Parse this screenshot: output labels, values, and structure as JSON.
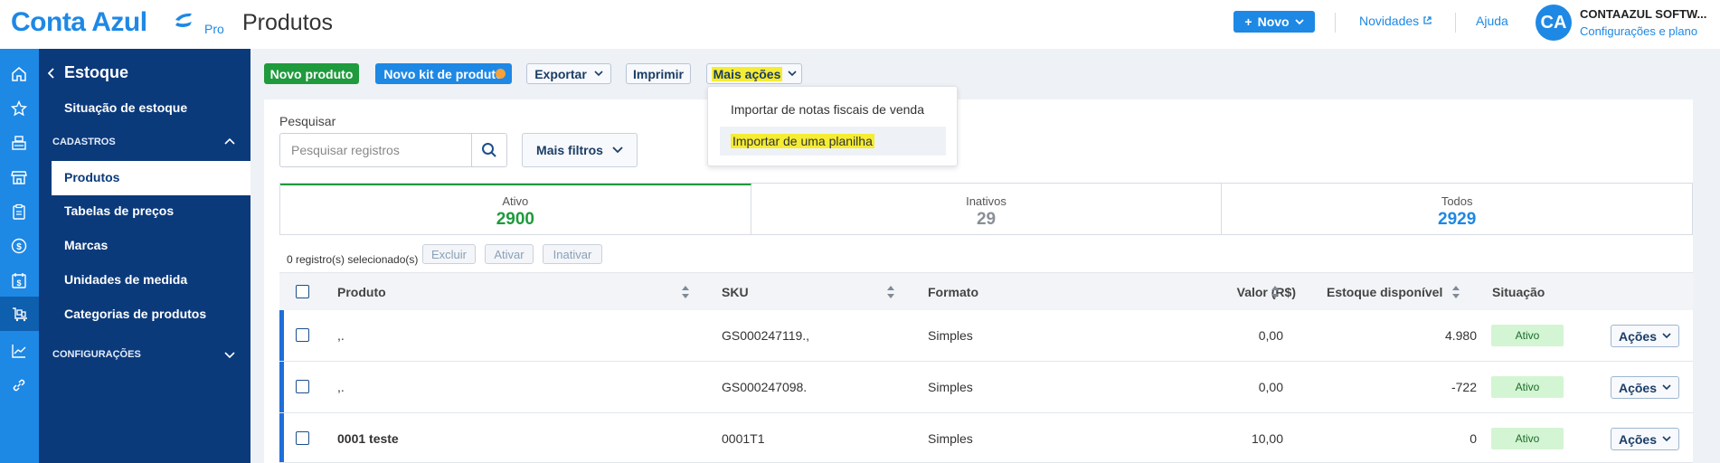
{
  "header": {
    "logo_text": "Conta Azul",
    "logo_badge": "Pro",
    "page_title": "Produtos",
    "novo_label": "Novo",
    "novidades_label": "Novidades",
    "ajuda_label": "Ajuda",
    "avatar_initials": "CA",
    "company_name": "CONTAAZUL SOFTW...",
    "plan_link": "Configurações e plano",
    "brand_color": "#1e88e5"
  },
  "rail": {
    "icons": [
      "home-icon",
      "star-icon",
      "cash-register-icon",
      "store-icon",
      "clipboard-icon",
      "dollar-icon",
      "calendar-dollar-icon",
      "inventory-icon",
      "chart-icon",
      "link-icon"
    ],
    "active_index": 7
  },
  "sidebar": {
    "back_label": "Estoque",
    "situacao_label": "Situação de estoque",
    "cadastros_label": "CADASTROS",
    "items": [
      {
        "label": "Produtos",
        "active": true
      },
      {
        "label": "Tabelas de preços"
      },
      {
        "label": "Marcas"
      },
      {
        "label": "Unidades de medida"
      },
      {
        "label": "Categorias de produtos"
      }
    ],
    "configuracoes_label": "CONFIGURAÇÕES"
  },
  "toolbar": {
    "novo_produto": "Novo produto",
    "novo_kit": "Novo kit de produto",
    "exportar": "Exportar",
    "imprimir": "Imprimir",
    "mais_acoes": "Mais ações"
  },
  "dropdown": {
    "items": [
      "Importar de notas fiscais de venda",
      "Importar de uma planilha"
    ]
  },
  "search": {
    "label": "Pesquisar",
    "placeholder": "Pesquisar registros",
    "mais_filtros": "Mais filtros"
  },
  "tabs": [
    {
      "label": "Ativo",
      "count": "2900",
      "color": "#1f9a3d"
    },
    {
      "label": "Inativos",
      "count": "29",
      "color": "#8a8f96"
    },
    {
      "label": "Todos",
      "count": "2929",
      "color": "#1e88e5"
    }
  ],
  "bulk": {
    "selected_text": "0 registro(s) selecionado(s)",
    "excluir": "Excluir",
    "ativar": "Ativar",
    "inativar": "Inativar"
  },
  "table": {
    "columns": [
      "Produto",
      "SKU",
      "Formato",
      "Valor (R$)",
      "Estoque disponível",
      "Situação"
    ],
    "rows": [
      {
        "produto": ",.",
        "sku": "GS000247119.,",
        "formato": "Simples",
        "valor": "0,00",
        "estoque": "4.980",
        "situacao": "Ativo",
        "acoes": "Ações",
        "bold": false
      },
      {
        "produto": ",.",
        "sku": "GS000247098.",
        "formato": "Simples",
        "valor": "0,00",
        "estoque": "-722",
        "situacao": "Ativo",
        "acoes": "Ações",
        "bold": false
      },
      {
        "produto": "0001 teste",
        "sku": "0001T1",
        "formato": "Simples",
        "valor": "10,00",
        "estoque": "0",
        "situacao": "Ativo",
        "acoes": "Ações",
        "bold": true
      }
    ]
  }
}
